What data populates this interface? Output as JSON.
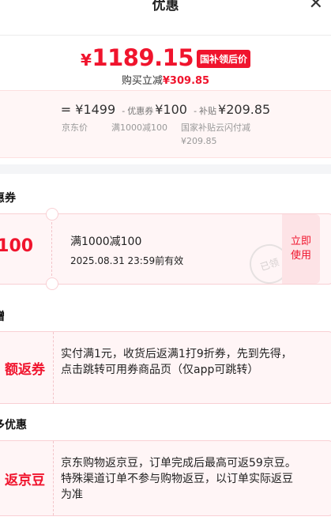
{
  "header": {
    "title": "优惠",
    "close_icon": "close-icon"
  },
  "price": {
    "currency": "¥",
    "amount": "1189.15",
    "tag": "国补领后价",
    "buy_label": "购买立减",
    "buy_amount": "¥309.85"
  },
  "calc": {
    "equals": "=",
    "jd_price": "¥1499",
    "minus1": "-",
    "coupon_label": "优惠券",
    "coupon_value": "¥100",
    "minus2": "-",
    "subsidy_label": "补贴",
    "subsidy_value": "¥209.85",
    "sub_jd": "京东价",
    "sub_coupon": "满1000减100",
    "sub_subsidy_line1": "国家补贴云闪付减",
    "sub_subsidy_line2": "¥209.85"
  },
  "sections": {
    "coupon_title": "惠券",
    "gift_title": "赠",
    "more_title": "多优惠"
  },
  "coupon": {
    "yen": "¥",
    "amount": "100",
    "name": "满1000减100",
    "expiry": "2025.08.31 23:59前有效",
    "button": "立即使用",
    "stamp": "已领"
  },
  "gift": {
    "label": "额返券",
    "text": "实付满1元，收货后返满1打9折券，先到先得，点击跳转可用券商品页（仅app可跳转）"
  },
  "more": {
    "label": "返京豆",
    "text": "京东购物返京豆，订单完成后最高可返59京豆。特殊渠道订单不参与购物返豆，以订单实际返豆为准"
  },
  "colors": {
    "accent": "#f0142d",
    "card_bg": "#fff5f6",
    "card_border": "#f9d0d4"
  }
}
